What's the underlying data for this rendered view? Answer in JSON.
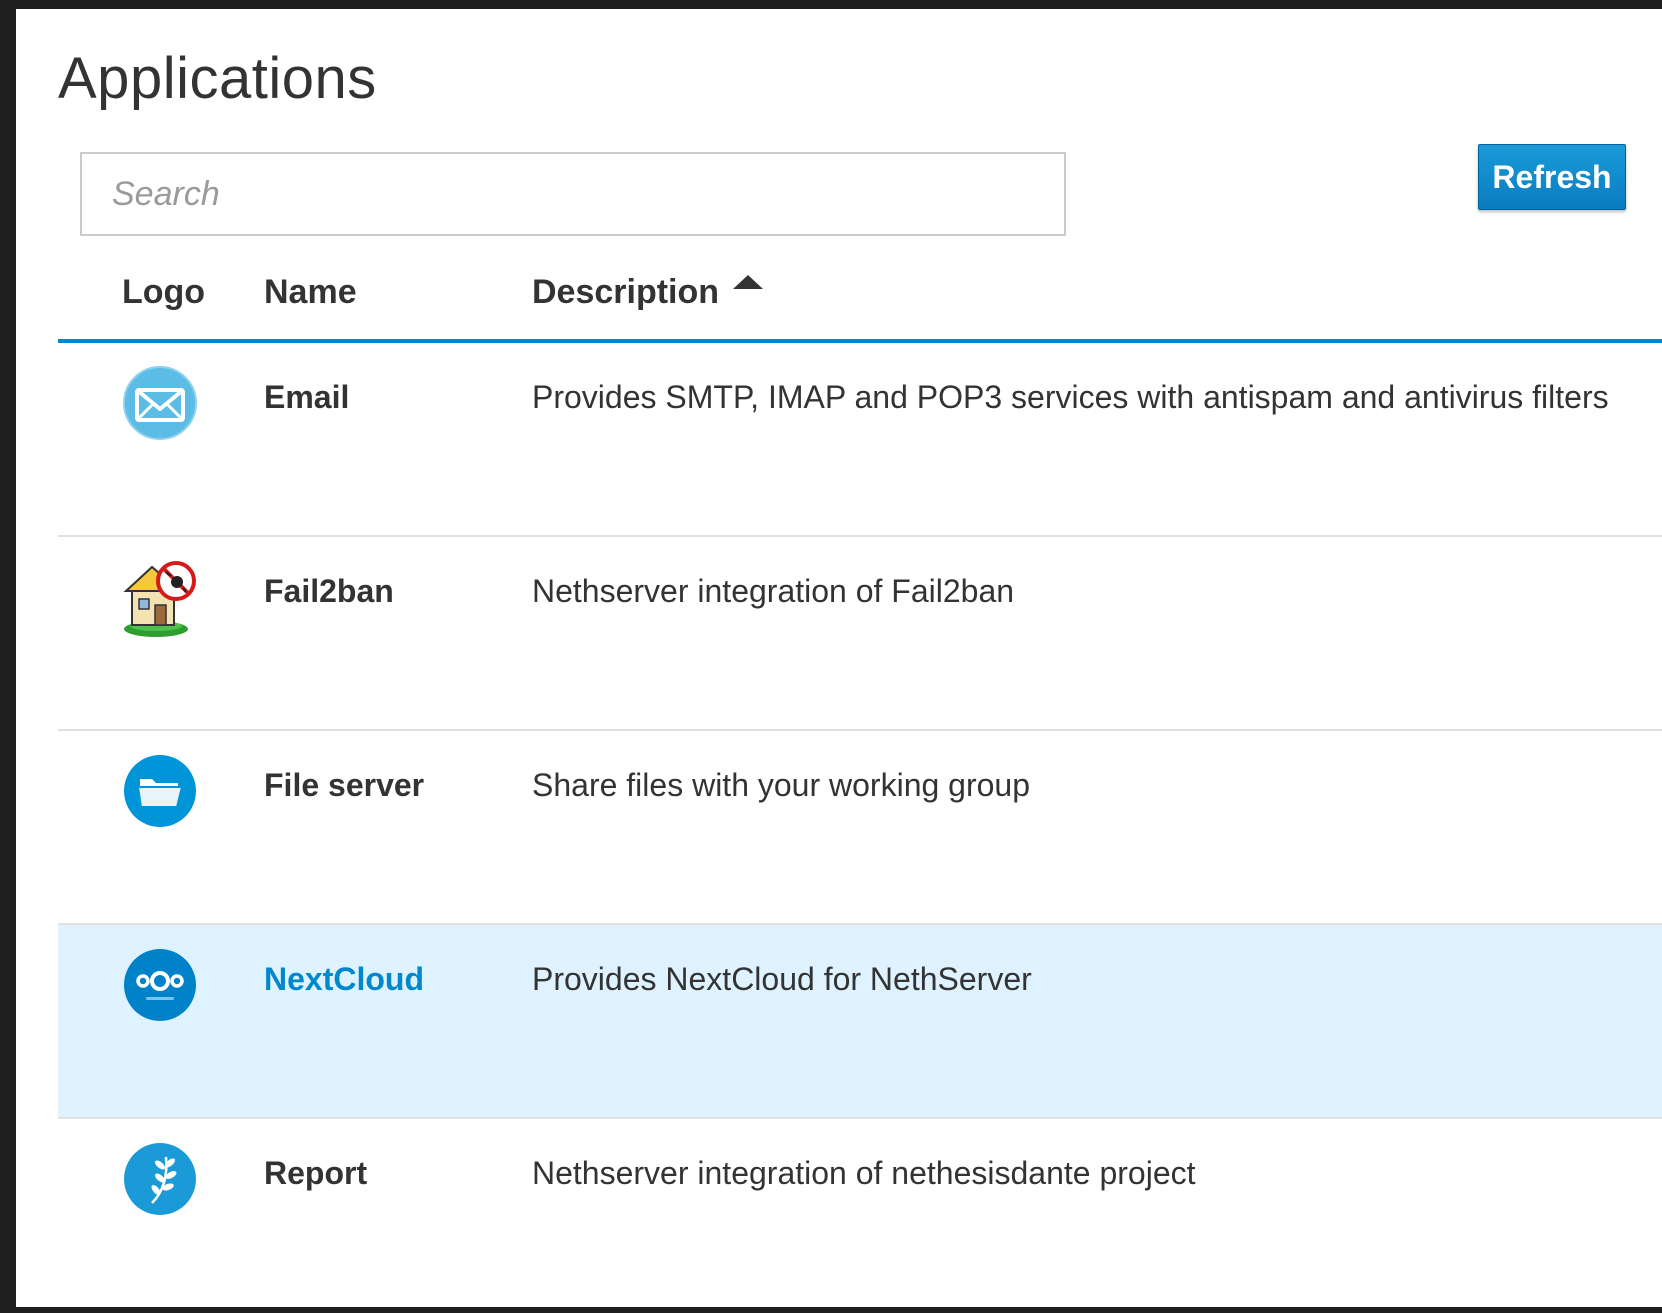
{
  "page": {
    "title": "Applications"
  },
  "search": {
    "placeholder": "Search",
    "value": ""
  },
  "toolbar": {
    "refresh_label": "Refresh"
  },
  "table": {
    "columns": {
      "logo": "Logo",
      "name": "Name",
      "description": "Description"
    },
    "sort": {
      "column": "Description",
      "direction": "ascending"
    },
    "rows": [
      {
        "name": "Email",
        "description": "Provides SMTP, IMAP and POP3 services with antispam and antivirus filters",
        "icon": "email-envelope-icon",
        "selected": false
      },
      {
        "name": "Fail2ban",
        "description": "Nethserver integration of Fail2ban",
        "icon": "fail2ban-house-icon",
        "selected": false
      },
      {
        "name": "File server",
        "description": "Share files with your working group",
        "icon": "folder-icon",
        "selected": false
      },
      {
        "name": "NextCloud",
        "description": "Provides NextCloud for NethServer",
        "icon": "nextcloud-icon",
        "selected": true
      },
      {
        "name": "Report",
        "description": "Nethserver integration of nethesisdante project",
        "icon": "report-laurel-icon",
        "selected": false
      }
    ]
  },
  "colors": {
    "accent": "#0088ce",
    "selected_row_bg": "#def3ff",
    "button_bg": "#0a7cc0",
    "text": "#333333",
    "email_icon": "#5bbde6",
    "folder_icon": "#0095d8",
    "nextcloud_icon": "#0082c9",
    "report_icon": "#1a9bd8"
  }
}
